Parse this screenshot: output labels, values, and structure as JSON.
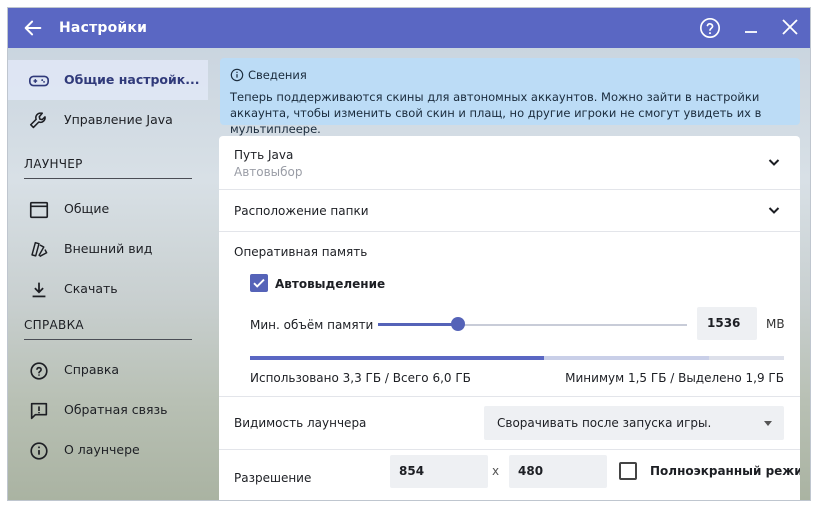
{
  "window": {
    "title": "Настройки",
    "icons": {
      "back": "arrow-left-icon",
      "help": "help-circle-icon",
      "minimize": "minimize-icon",
      "close": "close-icon"
    },
    "accent_color": "#5a67c3"
  },
  "sidebar": {
    "items_top": [
      {
        "label": "Общие настройк...",
        "icon": "gamepad-icon",
        "active": true
      },
      {
        "label": "Управление Java",
        "icon": "wrench-icon",
        "active": false
      }
    ],
    "section_launcher": "ЛАУНЧЕР",
    "items_launcher": [
      {
        "label": "Общие",
        "icon": "window-icon"
      },
      {
        "label": "Внешний вид",
        "icon": "palette-icon"
      },
      {
        "label": "Скачать",
        "icon": "download-icon"
      }
    ],
    "section_help": "СПРАВКА",
    "items_help": [
      {
        "label": "Справка",
        "icon": "question-icon"
      },
      {
        "label": "Обратная связь",
        "icon": "feedback-icon"
      },
      {
        "label": "О лаунчере",
        "icon": "info-icon"
      }
    ]
  },
  "info": {
    "title": "Сведения",
    "text": "Теперь поддерживаются скины для автономных аккаунтов. Можно зайти в настройки аккаунта, чтобы изменить свой скин и плащ, но другие игроки не смогут увидеть их в мультиплеере."
  },
  "settings": {
    "java_path": {
      "label": "Путь Java",
      "value": "Автовыбор"
    },
    "folder": {
      "label": "Расположение папки"
    },
    "memory": {
      "label": "Оперативная память",
      "auto_label": "Автовыделение",
      "auto_checked": true,
      "min_label": "Мин. объём памяти",
      "min_value": "1536",
      "unit": "MB",
      "slider_fraction": 0.26,
      "used_fraction": 0.55,
      "allocated_fraction": 0.86,
      "usage_left": "Использовано 3,3 ГБ / Всего 6,0 ГБ",
      "usage_right": "Минимум 1,5 ГБ / Выделено 1,9 ГБ"
    },
    "visibility": {
      "label": "Видимость лаунчера",
      "selected": "Сворачивать после запуска игры."
    },
    "resolution": {
      "label": "Разрешение",
      "width": "854",
      "sep": "x",
      "height": "480",
      "fullscreen_label": "Полноэкранный режим",
      "fullscreen_checked": false
    }
  }
}
